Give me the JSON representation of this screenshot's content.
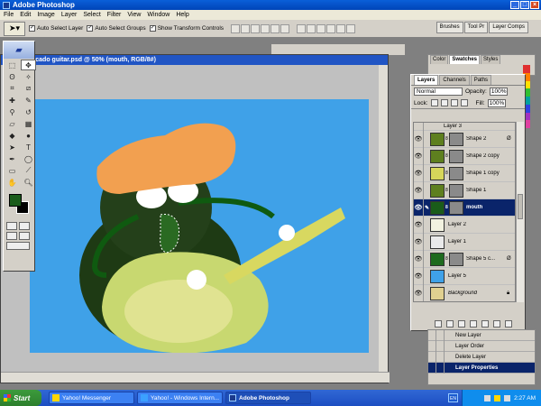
{
  "app": {
    "title": "Adobe Photoshop"
  },
  "menu": [
    "File",
    "Edit",
    "Image",
    "Layer",
    "Select",
    "Filter",
    "View",
    "Window",
    "Help"
  ],
  "options": {
    "auto_select_layer": "Auto Select Layer",
    "auto_select_groups": "Auto Select Groups",
    "show_transform": "Show Transform Controls",
    "palette_tabs": [
      "Brushes",
      "Tool Pr",
      "Layer Comps"
    ]
  },
  "document": {
    "title": "ocado guitar.psd @ 50% (mouth, RGB/8#)"
  },
  "swatches": {
    "tabs": [
      "Color",
      "Swatches",
      "Styles"
    ]
  },
  "layers_panel": {
    "tabs": [
      "Layers",
      "Channels",
      "Paths"
    ],
    "blend_mode": "Normal",
    "opacity_label": "Opacity:",
    "opacity_value": "100%",
    "lock_label": "Lock:",
    "fill_label": "Fill:",
    "fill_value": "100%",
    "layers": [
      {
        "name": "Layer 3",
        "thumb": "#ffffff",
        "mask": false,
        "selected": false
      },
      {
        "name": "Shape 2",
        "thumb": "#5e7f1f",
        "mask": true,
        "selected": false,
        "fx": true
      },
      {
        "name": "Shape 2 copy",
        "thumb": "#5e7f1f",
        "mask": true,
        "selected": false
      },
      {
        "name": "Shape 1 copy",
        "thumb": "#d6d65a",
        "mask": true,
        "selected": false
      },
      {
        "name": "Shape 1",
        "thumb": "#5e7f1f",
        "mask": true,
        "selected": false
      },
      {
        "name": "mouth",
        "thumb": "#1a5c1a",
        "mask": true,
        "selected": true
      },
      {
        "name": "Layer 2",
        "thumb": "#f2f2e0",
        "mask": false,
        "selected": false
      },
      {
        "name": "Layer 1",
        "thumb": "#eaeaea",
        "mask": false,
        "selected": false
      },
      {
        "name": "Shape 5 c...",
        "thumb": "#1e6a1e",
        "mask": true,
        "selected": false,
        "fx": true
      },
      {
        "name": "Layer 5",
        "thumb": "#3fa1e8",
        "mask": false,
        "selected": false
      },
      {
        "name": "Background",
        "thumb": "#e0d090",
        "mask": false,
        "selected": false,
        "locked": true
      }
    ]
  },
  "actions_panel": {
    "items": [
      "New Layer",
      "Layer Order",
      "Delete Layer",
      "Layer Properties"
    ],
    "selected_index": 3
  },
  "taskbar": {
    "start": "Start",
    "tasks": [
      "Yahoo! Messenger",
      "Yahoo! - Windows Intern...",
      "Adobe Photoshop"
    ],
    "lang": "EN",
    "clock": "2:27 AM"
  }
}
